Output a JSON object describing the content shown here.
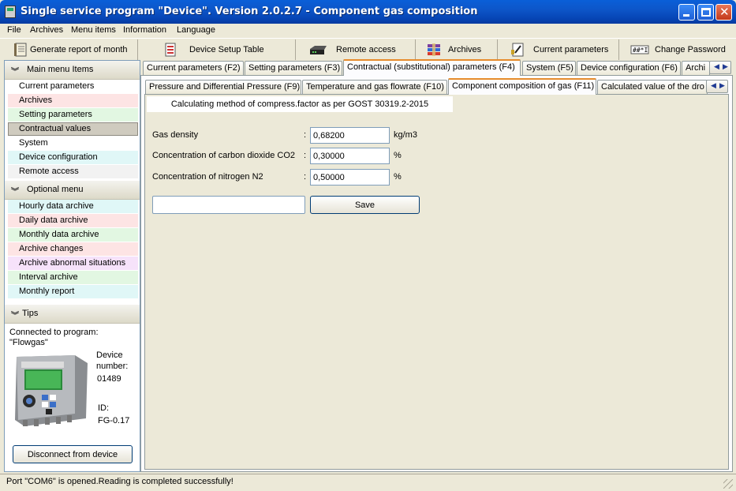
{
  "window": {
    "title": "Single service program \"Device\".   Version 2.0.2.7 - Component gas composition"
  },
  "menu": [
    "File",
    "Archives",
    "Menu items",
    "Information",
    "Language"
  ],
  "toolbar": [
    {
      "label": "Generate report of month",
      "icon": "report-book-icon"
    },
    {
      "label": "Device Setup Table",
      "icon": "document-table-icon"
    },
    {
      "label": "Remote access",
      "icon": "modem-icon"
    },
    {
      "label": "Archives",
      "icon": "archive-books-icon"
    },
    {
      "label": "Current parameters",
      "icon": "gauge-document-icon"
    },
    {
      "label": "Change Password",
      "icon": "password-field-icon"
    }
  ],
  "sidebar": {
    "main_header": "Main menu Items",
    "main_items": [
      {
        "label": "Current parameters",
        "color": "#ffffff"
      },
      {
        "label": "Archives",
        "color": "#fde4e4"
      },
      {
        "label": "Setting parameters",
        "color": "#e2f7e2"
      },
      {
        "label": "Contractual values",
        "color": "#cfcbbf",
        "selected": true
      },
      {
        "label": "System",
        "color": "#ffffff"
      },
      {
        "label": "Device configuration",
        "color": "#e0f7f7"
      },
      {
        "label": "Remote access",
        "color": "#f2f2f2"
      }
    ],
    "optional_header": "Optional menu",
    "optional_items": [
      {
        "label": "Hourly data archive",
        "color": "#e0f7f7"
      },
      {
        "label": "Daily data archive",
        "color": "#fde4e4"
      },
      {
        "label": "Monthly data archive",
        "color": "#e2f7e2"
      },
      {
        "label": "Archive changes",
        "color": "#fde4e4"
      },
      {
        "label": "Archive abnormal situations",
        "color": "#f6e2fa"
      },
      {
        "label": "Interval archive",
        "color": "#e2f7e2"
      },
      {
        "label": "Monthly report",
        "color": "#e0f7f7"
      }
    ],
    "tips_header": "Tips",
    "connected_line1": "Connected to  program:",
    "connected_line2": "\"Flowgas\"",
    "device_number_label1": "Device",
    "device_number_label2": "number:",
    "device_number": "01489",
    "id_label": "ID:",
    "id_value": "FG-0.17",
    "disconnect_label": "Disconnect from device"
  },
  "tabs_top": [
    {
      "label": "Current parameters (F2)"
    },
    {
      "label": "Setting parameters (F3)"
    },
    {
      "label": "Contractual (substitutional) parameters (F4)",
      "active": true
    },
    {
      "label": "System (F5)"
    },
    {
      "label": "Device configuration (F6)"
    },
    {
      "label": "Archi"
    }
  ],
  "tabs_sub": [
    {
      "label": "Pressure and Differential Pressure (F9)"
    },
    {
      "label": "Temperature and gas flowrate (F10)"
    },
    {
      "label": "Component composition of gas (F11)",
      "active": true
    },
    {
      "label": "Calculated value of the dro"
    }
  ],
  "content": {
    "method": "Calculating method of compress.factor as per GOST 30319.2-2015",
    "rows": [
      {
        "label": "Gas density",
        "value": "0,68200",
        "unit": "kg/m3"
      },
      {
        "label": "Concentration of carbon dioxide CO2",
        "value": "0,30000",
        "unit": "%"
      },
      {
        "label": "Concentration of nitrogen N2",
        "value": "0,50000",
        "unit": "%"
      }
    ],
    "blank_value": "",
    "save_label": "Save"
  },
  "status": "Port \"COM6\" is opened.Reading is completed successfully!"
}
